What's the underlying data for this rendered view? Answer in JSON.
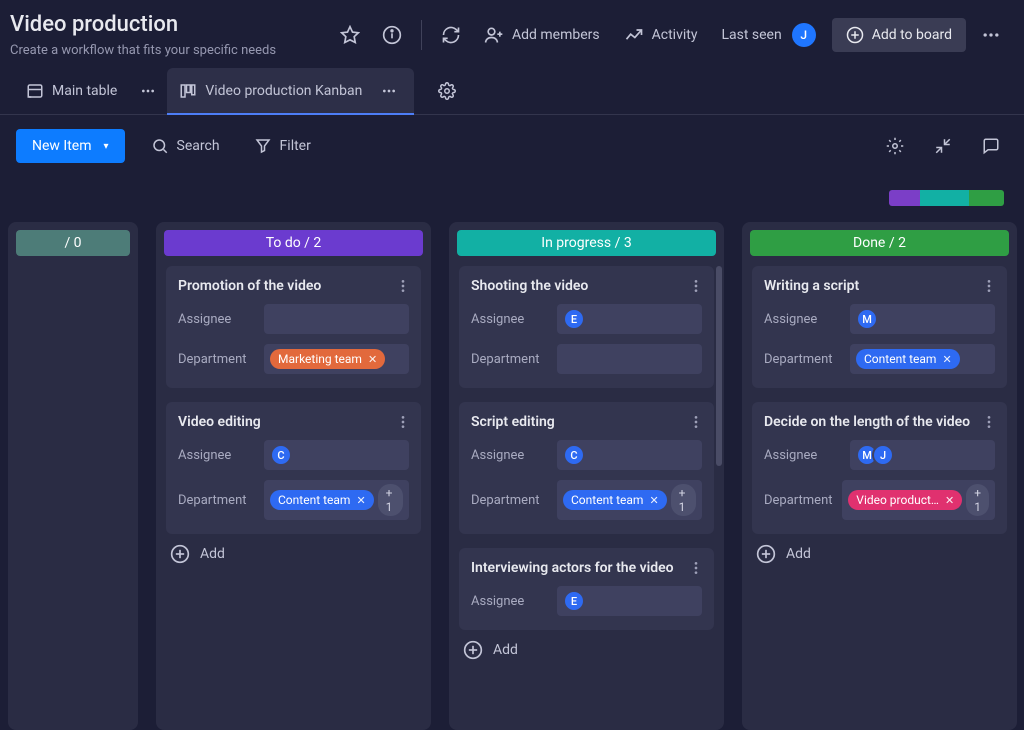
{
  "header": {
    "title": "Video production",
    "subtitle": "Create a workflow that fits your specific needs",
    "add_members": "Add members",
    "activity": "Activity",
    "last_seen": "Last seen",
    "last_seen_avatar": {
      "initial": "J",
      "color": "#1f76ff"
    },
    "add_to_board": "Add to board"
  },
  "tabs": {
    "main": "Main table",
    "kanban": "Video production Kanban"
  },
  "toolbar": {
    "new_item": "New Item",
    "search": "Search",
    "filter": "Filter"
  },
  "segment_colors": [
    "#7b3ec7",
    "#12b0a4",
    "#2f9e44"
  ],
  "field_labels": {
    "assignee": "Assignee",
    "department": "Department"
  },
  "add_label": "Add",
  "columns": [
    {
      "id": "blank",
      "header": "/ 0",
      "header_color": "#4d7c78",
      "truncated": true,
      "cards": []
    },
    {
      "id": "todo",
      "header": "To do / 2",
      "header_color": "#6b3bcf",
      "cards": [
        {
          "title": "Promotion of the video",
          "assignees": [],
          "department": {
            "tags": [
              {
                "label": "Marketing team",
                "color": "#e2693c",
                "x": true
              }
            ]
          }
        },
        {
          "title": "Video editing",
          "assignees": [
            {
              "initial": "C",
              "color": "#2e6af2"
            }
          ],
          "department": {
            "tags": [
              {
                "label": "Content team",
                "color": "#2e6af2",
                "x": true
              }
            ],
            "plus": "+ 1"
          }
        }
      ]
    },
    {
      "id": "inprogress",
      "header": "In progress / 3",
      "header_color": "#12b0a4",
      "show_scroll": true,
      "cards": [
        {
          "title": "Shooting the video",
          "assignees": [
            {
              "initial": "E",
              "color": "#2e6af2"
            }
          ],
          "department": {
            "tags": []
          }
        },
        {
          "title": "Script editing",
          "assignees": [
            {
              "initial": "C",
              "color": "#2e6af2"
            }
          ],
          "department": {
            "tags": [
              {
                "label": "Content team",
                "color": "#2e6af2",
                "x": true
              }
            ],
            "plus": "+ 1"
          }
        },
        {
          "title": "Interviewing actors for the video",
          "assignees": [
            {
              "initial": "E",
              "color": "#2e6af2"
            }
          ],
          "truncated_after_assignee": true
        }
      ]
    },
    {
      "id": "done",
      "header": "Done / 2",
      "header_color": "#2f9e44",
      "cards": [
        {
          "title": "Writing a script",
          "assignees": [
            {
              "initial": "M",
              "color": "#2e6af2"
            }
          ],
          "department": {
            "tags": [
              {
                "label": "Content team",
                "color": "#2e6af2",
                "x": true
              }
            ]
          }
        },
        {
          "title": "Decide on the length of the video",
          "assignees": [
            {
              "initial": "M",
              "color": "#2e6af2"
            },
            {
              "initial": "J",
              "color": "#2e6af2"
            }
          ],
          "department": {
            "tags": [
              {
                "label": "Video product…",
                "color": "#e0316f",
                "x": true
              }
            ],
            "plus": "+ 1"
          }
        }
      ]
    }
  ]
}
